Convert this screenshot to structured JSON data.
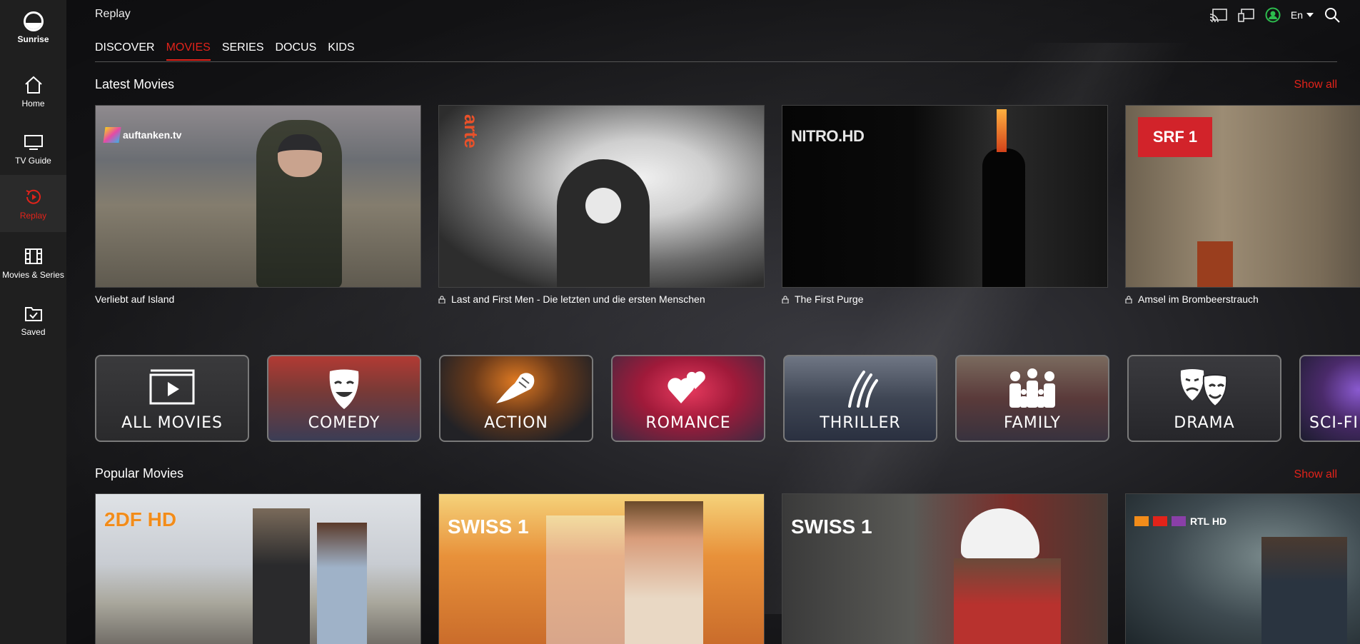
{
  "brand": {
    "name": "Sunrise"
  },
  "sidebar": {
    "items": [
      {
        "label": "Home",
        "icon": "home-icon"
      },
      {
        "label": "TV Guide",
        "icon": "tv-icon"
      },
      {
        "label": "Replay",
        "icon": "replay-icon",
        "active": true
      },
      {
        "label": "Movies & Series",
        "icon": "film-icon"
      },
      {
        "label": "Saved",
        "icon": "saved-icon"
      }
    ]
  },
  "header": {
    "title": "Replay",
    "language": "En",
    "icons": [
      "cast-icon",
      "screen-icon",
      "profile-icon",
      "search-icon"
    ]
  },
  "tabs": [
    {
      "label": "DISCOVER"
    },
    {
      "label": "MOVIES",
      "active": true
    },
    {
      "label": "SERIES"
    },
    {
      "label": "DOCUS"
    },
    {
      "label": "KIDS"
    }
  ],
  "latest": {
    "title": "Latest Movies",
    "show_all": "Show all",
    "items": [
      {
        "title": "Verliebt auf Island",
        "channel": "auftanken.tv",
        "locked": false
      },
      {
        "title": "Last and First Men - Die letzten und die ersten Menschen",
        "channel": "arte",
        "locked": true
      },
      {
        "title": "The First Purge",
        "channel": "NITRO.HD",
        "locked": true
      },
      {
        "title": "Amsel im Brombeerstrauch",
        "channel": "SRF 1",
        "locked": true
      }
    ]
  },
  "genres": [
    {
      "label": "ALL MOVIES"
    },
    {
      "label": "COMEDY"
    },
    {
      "label": "ACTION"
    },
    {
      "label": "ROMANCE"
    },
    {
      "label": "THRILLER"
    },
    {
      "label": "FAMILY"
    },
    {
      "label": "DRAMA"
    },
    {
      "label": "SCI-FI &"
    }
  ],
  "popular": {
    "title": "Popular Movies",
    "show_all": "Show all",
    "items": [
      {
        "channel": "2DF HD"
      },
      {
        "channel": "SWISS 1"
      },
      {
        "channel": "SWISS 1"
      },
      {
        "channel": "RTL HD"
      }
    ]
  },
  "colors": {
    "accent": "#e2231a",
    "sidebar": "#1f1f1f",
    "background": "#111111"
  }
}
